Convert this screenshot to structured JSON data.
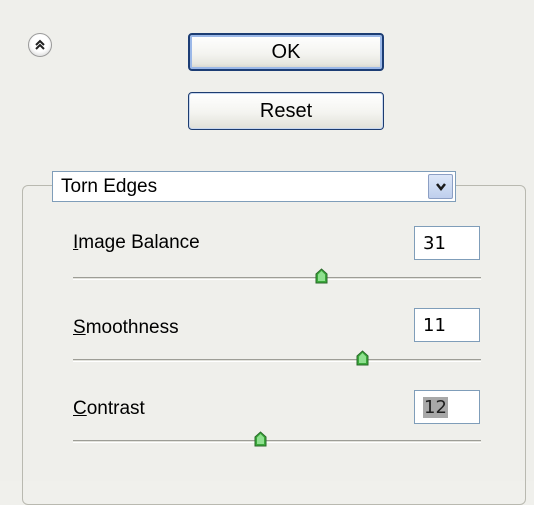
{
  "buttons": {
    "ok_label": "OK",
    "reset_label": "Reset"
  },
  "filter": {
    "selected": "Torn Edges"
  },
  "params": [
    {
      "label_ul": "I",
      "label_rest": "mage Balance",
      "value": "31",
      "slider_fraction": 0.61
    },
    {
      "label_ul": "S",
      "label_rest": "moothness",
      "value": "11",
      "slider_fraction": 0.71
    },
    {
      "label_ul": "C",
      "label_rest": "ontrast",
      "value": "12",
      "slider_fraction": 0.46,
      "value_selected": true
    }
  ],
  "icons": {
    "collapse": "double-chevron-up-icon",
    "dropdown": "chevron-down-icon",
    "slider_thumb": "slider-thumb-icon"
  },
  "colors": {
    "panel_bg": "#efefeb",
    "button_border": "#1c3d74",
    "field_border": "#7f9db9",
    "thumb_green": "#3aa83a",
    "selection_bg": "#a8a8a8"
  }
}
